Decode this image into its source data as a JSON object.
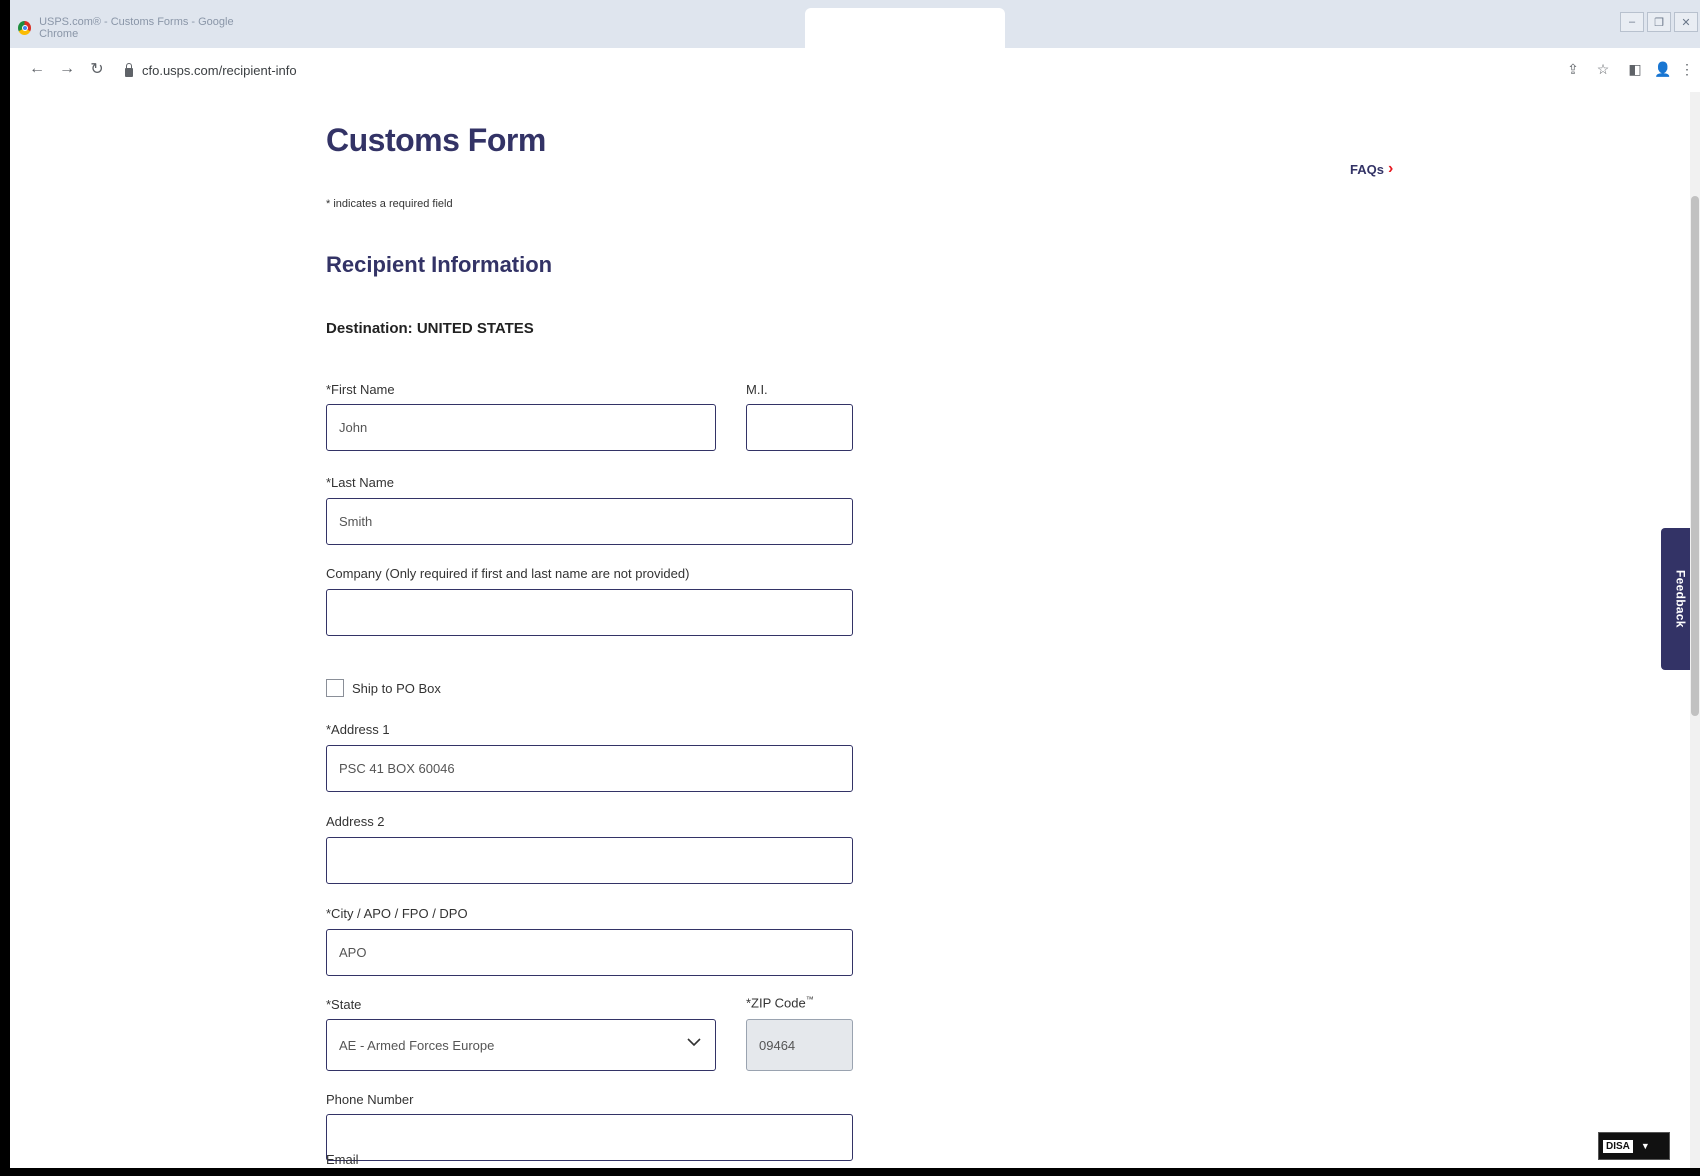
{
  "browser": {
    "tab_title": "USPS.com® - Customs Forms - Google Chrome",
    "url": "cfo.usps.com/recipient-info"
  },
  "page": {
    "title": "Customs Form",
    "faqs_link": "FAQs",
    "required_note": "* indicates a required field",
    "section_title": "Recipient Information",
    "destination": "Destination: UNITED STATES"
  },
  "form": {
    "first_name": {
      "label": "*First Name",
      "value": "John"
    },
    "mi": {
      "label": "M.I.",
      "value": ""
    },
    "last_name": {
      "label": "*Last Name",
      "value": "Smith"
    },
    "company": {
      "label": "Company (Only required if first and last name are not provided)",
      "value": ""
    },
    "po_box": {
      "label": "Ship to PO Box",
      "checked": false
    },
    "address1": {
      "label": "*Address 1",
      "value": "PSC 41 BOX 60046"
    },
    "address2": {
      "label": "Address 2",
      "value": ""
    },
    "city": {
      "label": "*City / APO / FPO / DPO",
      "value": "APO"
    },
    "state": {
      "label": "*State",
      "value": "AE - Armed Forces Europe"
    },
    "zip": {
      "label": "*ZIP Code",
      "trademark": "™",
      "value": "09464"
    },
    "phone": {
      "label": "Phone Number",
      "value": ""
    },
    "email": {
      "label": "Email"
    }
  },
  "feedback_tab": "Feedback",
  "disa_badge": "DISA",
  "colors": {
    "heading": "#333366",
    "accent_red": "#e71921",
    "field_border": "#333366",
    "feedback_bg": "#333366"
  },
  "icons": [
    "chrome-logo-icon",
    "back-arrow-icon",
    "forward-arrow-icon",
    "reload-icon",
    "lock-icon",
    "share-icon",
    "star-icon",
    "sidepanel-icon",
    "profile-icon",
    "menu-dots-icon",
    "chevron-right-icon",
    "chevron-down-icon"
  ]
}
